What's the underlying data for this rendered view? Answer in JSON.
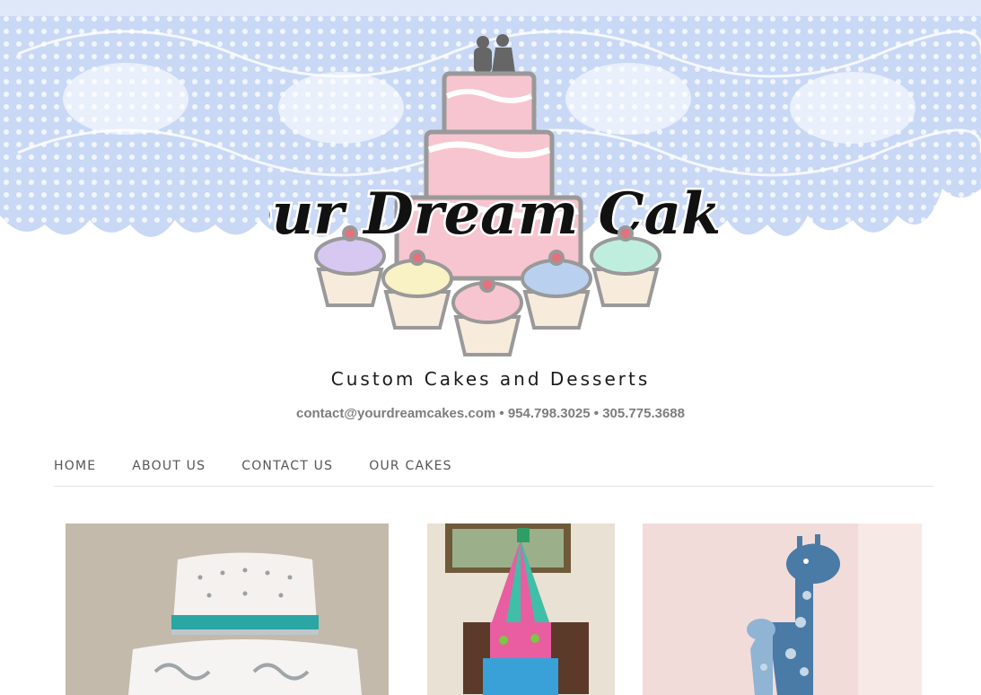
{
  "header": {
    "logo_text": "Your Dream Cakes",
    "tagline": "Custom Cakes and Desserts",
    "contact": {
      "email": "contact@yourdreamcakes.com",
      "separator": "•",
      "phone1": "954.798.3025",
      "phone2": "305.775.3688"
    }
  },
  "nav": {
    "items": [
      {
        "label": "HOME"
      },
      {
        "label": "ABOUT US"
      },
      {
        "label": "CONTACT US"
      },
      {
        "label": "OUR CAKES"
      }
    ]
  },
  "colors": {
    "lace": "#c9d8f5",
    "pink": "#f7c5cf",
    "text_gray": "#7d7d7d"
  },
  "gallery": {
    "images": [
      {
        "name": "white-teal-tiered-cake"
      },
      {
        "name": "circus-tent-cake"
      },
      {
        "name": "blue-giraffe-toppers"
      }
    ]
  }
}
